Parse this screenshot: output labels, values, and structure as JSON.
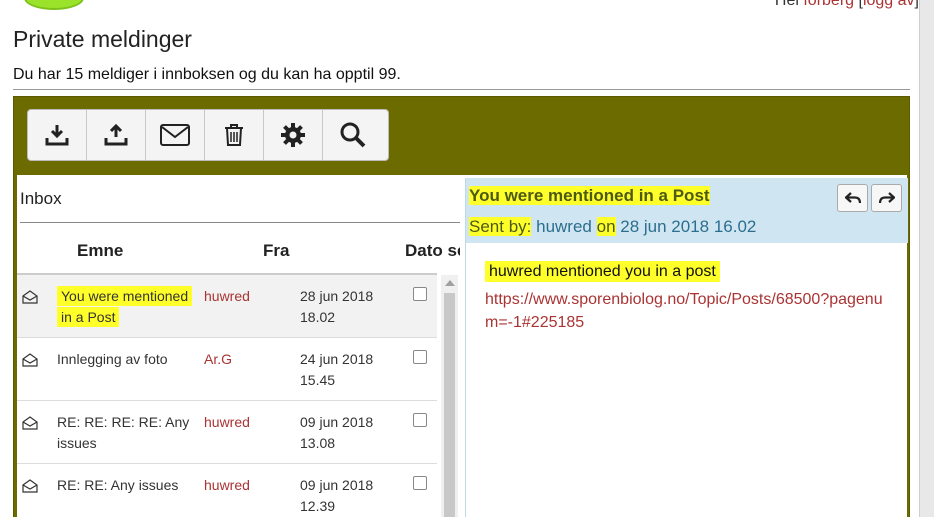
{
  "top": {
    "user_fragment": "Hei",
    "username": "forberg",
    "logout": "logg av"
  },
  "page_title": "Private meldinger",
  "info_text": "Du har 15 meldiger i innboksen og du kan ha opptil 99.",
  "toolbar": {
    "buttons": [
      {
        "name": "download-icon"
      },
      {
        "name": "upload-icon"
      },
      {
        "name": "envelope-icon"
      },
      {
        "name": "trash-icon"
      },
      {
        "name": "gear-icon"
      },
      {
        "name": "search-icon"
      }
    ]
  },
  "inbox": {
    "title": "Inbox",
    "columns": {
      "subject": "Emne",
      "from": "Fra",
      "date": "Dato sendt"
    },
    "rows": [
      {
        "subject": "You were mentioned in a Post",
        "from": "huwred",
        "date": "28 jun 2018 18.02",
        "selected": true
      },
      {
        "subject": "Innlegging av foto",
        "from": "Ar.G",
        "date": "24 jun 2018 15.45",
        "selected": false
      },
      {
        "subject": "RE: RE: RE: RE: Any issues",
        "from": "huwred",
        "date": "09 jun 2018 13.08",
        "selected": false
      },
      {
        "subject": "RE: RE: Any issues",
        "from": "huwred",
        "date": "09 jun 2018 12.39",
        "selected": false
      }
    ]
  },
  "message": {
    "subject": "You were mentioned in a Post",
    "sent_by_label": "Sent by:",
    "sender": "huwred",
    "on_label": "on",
    "date": "28 jun 2018 16.02",
    "body": "huwred mentioned you in a post",
    "link": "https://www.sporenbiolog.no/Topic/Posts/68500?pagenum=-1#225185"
  },
  "colors": {
    "accent": "#6b6b00",
    "highlight": "#ffff2a",
    "link": "#aa3333",
    "header_bg": "#cfe6f2"
  }
}
